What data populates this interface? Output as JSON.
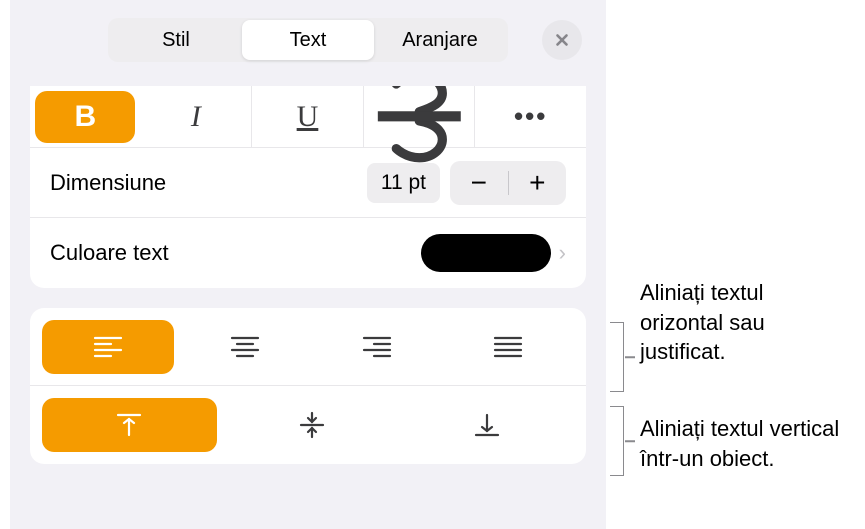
{
  "tabs": {
    "style": "Stil",
    "text": "Text",
    "arrange": "Aranjare"
  },
  "fontStyles": {
    "bold": "B",
    "italic": "I",
    "underline": "U",
    "strike": "S",
    "more": "•••"
  },
  "size": {
    "label": "Dimensiune",
    "value": "11 pt",
    "minus": "−",
    "plus": "+"
  },
  "textColor": {
    "label": "Culoare text",
    "value": "#000000"
  },
  "callouts": {
    "horizontal": "Aliniați textul orizontal sau justificat.",
    "vertical": "Aliniați textul vertical într-un obiect."
  }
}
